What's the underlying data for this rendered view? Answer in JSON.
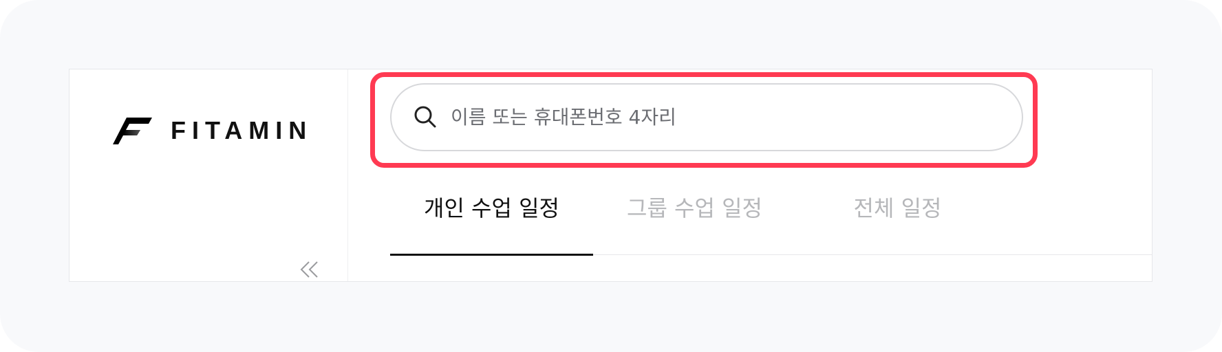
{
  "brand": {
    "name": "FITAMIN",
    "icon": "fitamin-logo-icon"
  },
  "sidebar": {
    "collapse_icon": "double-chevron-left-icon"
  },
  "search": {
    "placeholder": "이름 또는 휴대폰번호 4자리",
    "value": "",
    "icon": "search-icon"
  },
  "tabs": [
    {
      "label": "개인 수업 일정",
      "active": true
    },
    {
      "label": "그룹 수업 일정",
      "active": false
    },
    {
      "label": "전체 일정",
      "active": false
    }
  ],
  "colors": {
    "highlight": "#ff3a52",
    "tab_active": "#111111",
    "tab_inactive": "#b6b7ba",
    "background": "#f8f9fb"
  }
}
